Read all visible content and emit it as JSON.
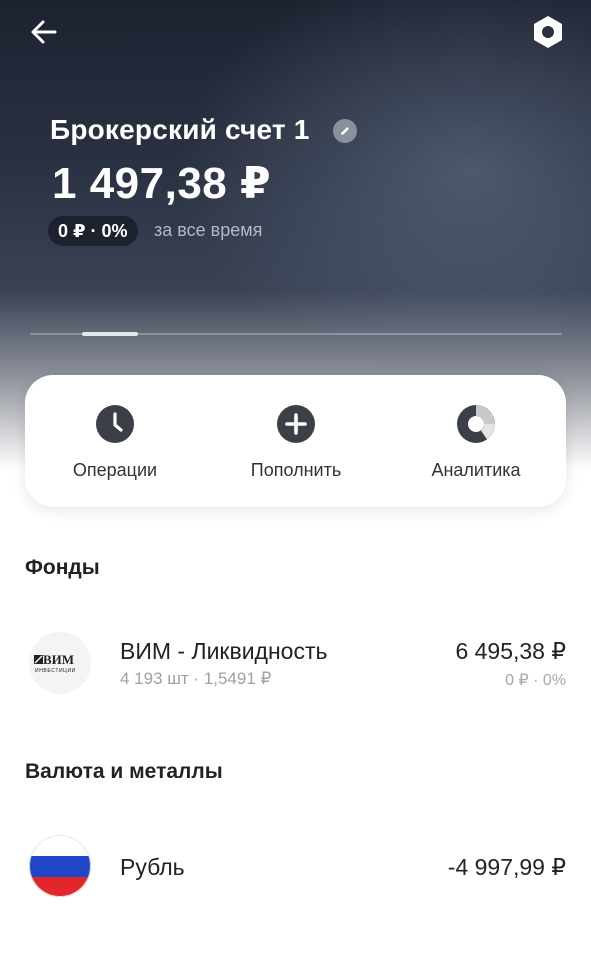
{
  "header": {
    "back_icon": "arrow-left-icon",
    "settings_icon": "hexagon-settings-icon"
  },
  "account": {
    "title": "Брокерский счет 1",
    "edit_icon": "pencil-icon",
    "balance": "1 497,38 ₽",
    "change": "0 ₽ · 0%",
    "change_period": "за все время"
  },
  "pager": {
    "pages": 1,
    "active": 1
  },
  "actions": [
    {
      "label": "Операции",
      "icon": "clock-icon"
    },
    {
      "label": "Пополнить",
      "icon": "plus-circle-icon"
    },
    {
      "label": "Аналитика",
      "icon": "donut-chart-icon"
    }
  ],
  "funds": {
    "title": "Фонды",
    "items": [
      {
        "name": "ВИМ - Ликвидность",
        "logo_text": "ВИМ",
        "logo_subtext": "ИНВЕСТИЦИИ",
        "details": "4 193 шт · 1,5491 ₽",
        "value": "6 495,38 ₽",
        "change": "0 ₽ · 0%"
      }
    ]
  },
  "currencies": {
    "title": "Валюта и металлы",
    "items": [
      {
        "name": "Рубль",
        "flag_icon": "russia-flag-icon",
        "value": "-4 997,99 ₽"
      }
    ]
  },
  "colors": {
    "hero_top": "#1d2230",
    "hero_mid": "#3a4254",
    "icon_dark": "#3b3f46",
    "flag_white": "#ffffff",
    "flag_blue": "#1f47c8",
    "flag_red": "#e3262b"
  }
}
